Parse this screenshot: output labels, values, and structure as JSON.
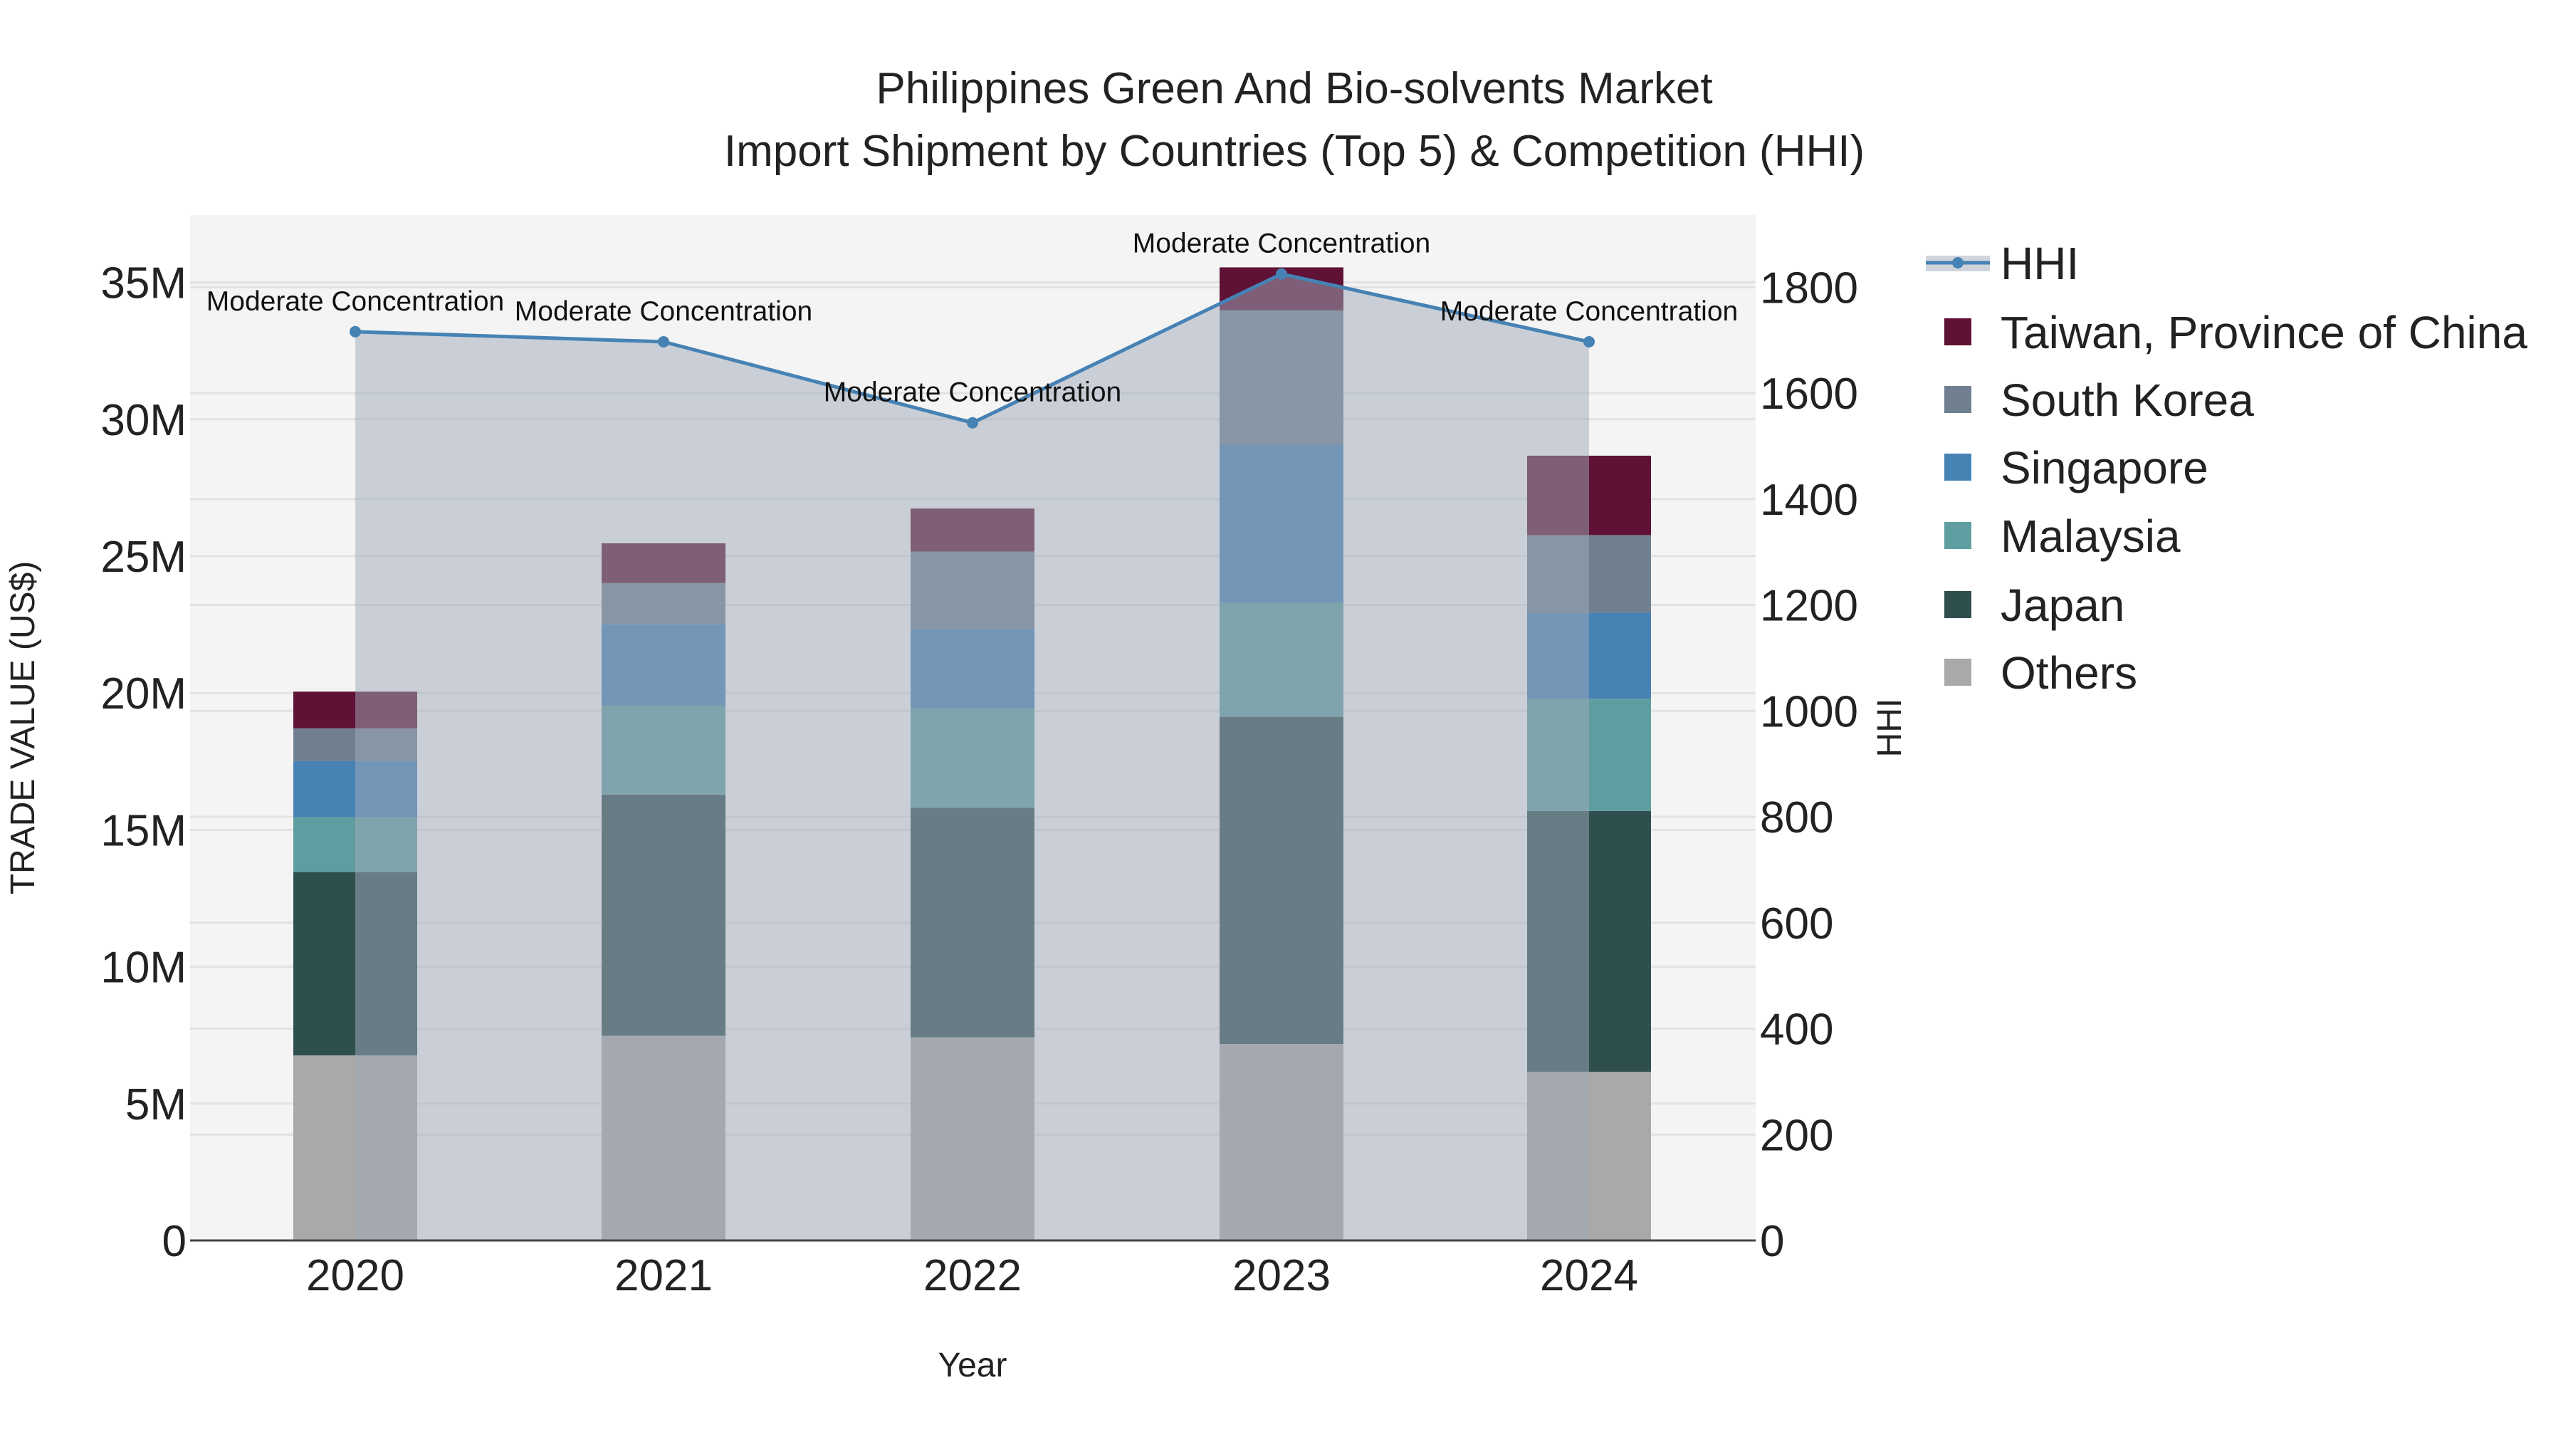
{
  "chart_data": {
    "type": "bar",
    "title": "Philippines Green And Bio-solvents Market",
    "subtitle": "Import Shipment by Countries (Top 5) & Competition (HHI)",
    "xlabel": "Year",
    "ylabel": "TRADE VALUE (US$)",
    "y2label": "HHI",
    "categories": [
      "2020",
      "2021",
      "2022",
      "2023",
      "2024"
    ],
    "ylim": [
      0,
      37000000
    ],
    "y2lim": [
      0,
      1930
    ],
    "yticks": [
      {
        "v": 0,
        "label": "0"
      },
      {
        "v": 5000000,
        "label": "5M"
      },
      {
        "v": 10000000,
        "label": "10M"
      },
      {
        "v": 15000000,
        "label": "15M"
      },
      {
        "v": 20000000,
        "label": "20M"
      },
      {
        "v": 25000000,
        "label": "25M"
      },
      {
        "v": 30000000,
        "label": "30M"
      },
      {
        "v": 35000000,
        "label": "35M"
      }
    ],
    "y2ticks": [
      {
        "v": 0,
        "label": "0"
      },
      {
        "v": 200,
        "label": "200"
      },
      {
        "v": 400,
        "label": "400"
      },
      {
        "v": 600,
        "label": "600"
      },
      {
        "v": 800,
        "label": "800"
      },
      {
        "v": 1000,
        "label": "1000"
      },
      {
        "v": 1200,
        "label": "1200"
      },
      {
        "v": 1400,
        "label": "1400"
      },
      {
        "v": 1600,
        "label": "1600"
      },
      {
        "v": 1800,
        "label": "1800"
      }
    ],
    "series": [
      {
        "name": "Others",
        "color": "#a9a9a9",
        "values": [
          6760000,
          7480000,
          7420000,
          7180000,
          6160000
        ]
      },
      {
        "name": "Japan",
        "color": "#2f4f4f",
        "values": [
          6700000,
          8810000,
          8390000,
          11950000,
          9530000
        ]
      },
      {
        "name": "Malaysia",
        "color": "#5f9ea0",
        "values": [
          2000000,
          3260000,
          3620000,
          4170000,
          4100000
        ]
      },
      {
        "name": "Singapore",
        "color": "#4682b4",
        "values": [
          2050000,
          2960000,
          2900000,
          5790000,
          3140000
        ]
      },
      {
        "name": "South Korea",
        "color": "#708090",
        "values": [
          1200000,
          1510000,
          2840000,
          4890000,
          2840000
        ]
      },
      {
        "name": "Taiwan, Province of China",
        "color": "#5f1235",
        "values": [
          1340000,
          1450000,
          1570000,
          1570000,
          2900000
        ]
      }
    ],
    "hhi": {
      "name": "HHI",
      "color": "#4682b4",
      "values": [
        1716,
        1697,
        1544,
        1825,
        1697
      ],
      "annotations": [
        "Moderate Concentration",
        "Moderate Concentration",
        "Moderate Concentration",
        "Moderate Concentration",
        "Moderate Concentration"
      ]
    },
    "legend_order": [
      "HHI",
      "Taiwan, Province of China",
      "South Korea",
      "Singapore",
      "Malaysia",
      "Japan",
      "Others"
    ],
    "legend_position": "right"
  }
}
